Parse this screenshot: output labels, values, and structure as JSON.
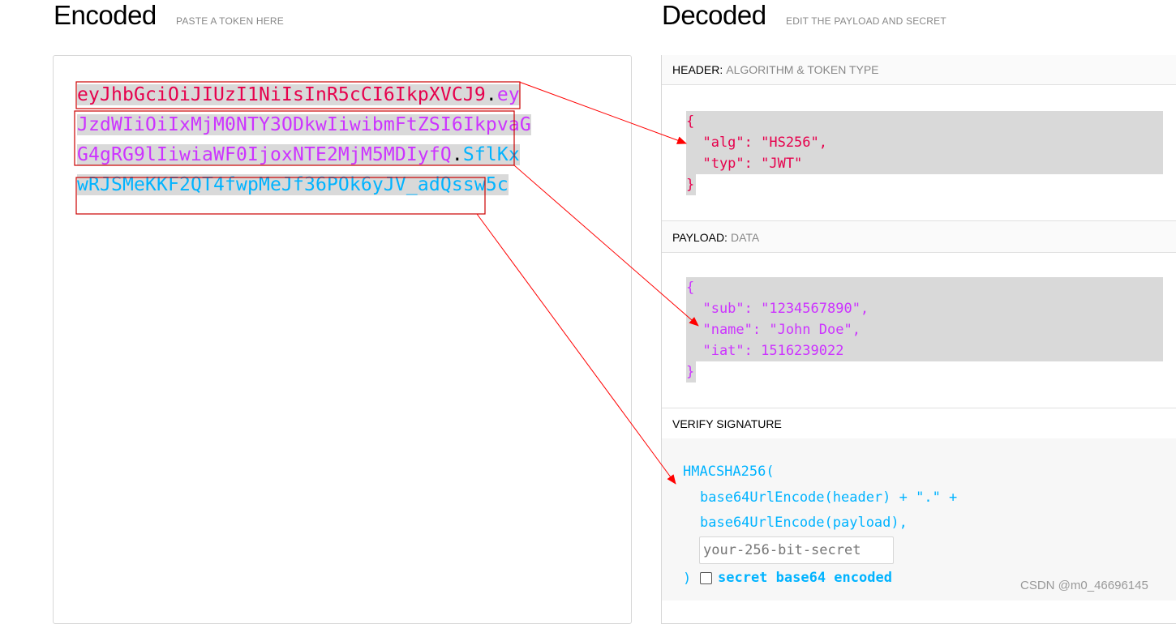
{
  "encoded": {
    "title": "Encoded",
    "subtitle": "PASTE A TOKEN HERE",
    "lines": [
      [
        {
          "text": "eyJhbGciOiJIUzI1NiIsInR5cCI6IkpXVCJ9",
          "part": "header"
        },
        {
          "text": ".",
          "part": "dot"
        },
        {
          "text": "ey",
          "part": "payload"
        }
      ],
      [
        {
          "text": "JzdWIiOiIxMjM0NTY3ODkwIiwibmFtZSI6IkpvaG",
          "part": "payload"
        }
      ],
      [
        {
          "text": "G4gRG9lIiwiaWF0IjoxNTE2MjM5MDIyfQ",
          "part": "payload"
        },
        {
          "text": ".",
          "part": "dot"
        },
        {
          "text": "SflKx",
          "part": "signature"
        }
      ],
      [
        {
          "text": "wRJSMeKKF2QT4fwpMeJf36POk6yJV_adQssw5c",
          "part": "signature"
        }
      ]
    ]
  },
  "decoded": {
    "title": "Decoded",
    "subtitle": "EDIT THE PAYLOAD AND SECRET",
    "header_section": {
      "label": "HEADER:",
      "desc": "ALGORITHM & TOKEN TYPE",
      "json_lines": [
        "{",
        "  \"alg\": \"HS256\",",
        "  \"typ\": \"JWT\""
      ],
      "closing": "}"
    },
    "payload_section": {
      "label": "PAYLOAD:",
      "desc": "DATA",
      "json_lines": [
        "{",
        "  \"sub\": \"1234567890\",",
        "  \"name\": \"John Doe\",",
        "  \"iat\": 1516239022"
      ],
      "closing": "}"
    },
    "verify_section": {
      "label": "VERIFY SIGNATURE",
      "line1": "HMACSHA256(",
      "line2": "base64UrlEncode(header) + \".\" +",
      "line3": "base64UrlEncode(payload),",
      "secret_placeholder": "your-256-bit-secret",
      "close_paren": ")",
      "checkbox_label": "secret base64 encoded"
    }
  },
  "watermark": "CSDN @m0_46696145",
  "colors": {
    "header": "#e6004c",
    "payload": "#cc33ff",
    "signature": "#00b3ff",
    "annotation": "#ff0000"
  }
}
